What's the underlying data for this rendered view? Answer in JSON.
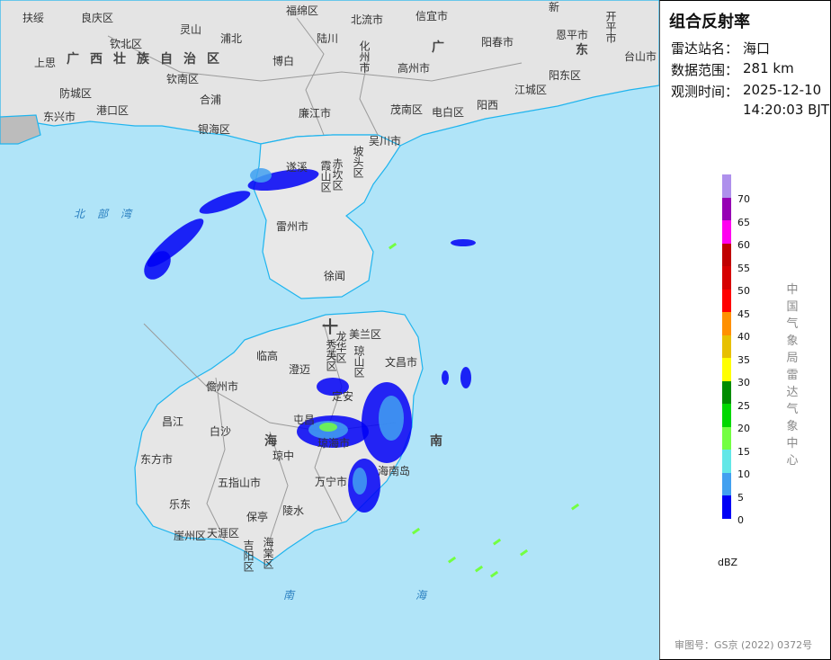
{
  "map": {
    "labels": [
      "扶绥",
      "良庆区",
      "福绵区",
      "北流市",
      "信宜市",
      "新",
      "灵山",
      "钦北区",
      "浦北",
      "陆川",
      "化州市",
      "广",
      "阳春市",
      "恩平市",
      "开平市",
      "台山市",
      "上思",
      "广西壮族自治区",
      "博白",
      "高州市",
      "东",
      "钦南区",
      "阳东区",
      "防城区",
      "合浦",
      "江城区",
      "东兴市",
      "港口区",
      "廉江市",
      "茂南区",
      "电白区",
      "阳西",
      "银海区",
      "吴川市",
      "坡头区",
      "遂溪",
      "赤坎区",
      "霞山区",
      "雷州市",
      "徐闻",
      "秀英区",
      "龙华区",
      "美兰区",
      "琼山区",
      "临高",
      "澄迈",
      "文昌市",
      "儋州市",
      "定安",
      "屯昌",
      "昌江",
      "琼海市",
      "白沙",
      "海",
      "南",
      "琼中",
      "东方市",
      "海南岛",
      "万宁市",
      "五指山市",
      "乐东",
      "保亭",
      "陵水",
      "崖州区",
      "天涯区",
      "吉阳区",
      "海棠区"
    ],
    "sea_labels": [
      "北部湾",
      "南",
      "海"
    ],
    "radar_center_marker": "十"
  },
  "panel": {
    "title": "组合反射率",
    "station_label": "雷达站名：",
    "station_value": "海口",
    "range_label": "数据范围：",
    "range_value": "281 km",
    "time_label": "观测时间：",
    "time_date": "2025-12-10",
    "time_clock": "14:20:03 BJT",
    "legend": {
      "colors": [
        "#ae90ec",
        "#9600b4",
        "#ff00f0",
        "#c00000",
        "#d60000",
        "#ff0000",
        "#ff9000",
        "#e7c000",
        "#ffff00",
        "#008c00",
        "#00d800",
        "#73ff42",
        "#63e7e7",
        "#42a0f0",
        "#0000f6"
      ],
      "ticks": [
        "70",
        "65",
        "60",
        "55",
        "50",
        "45",
        "40",
        "35",
        "30",
        "25",
        "20",
        "15",
        "10",
        "5",
        "0"
      ],
      "unit": "dBZ"
    },
    "organization": "中国气象局雷达气象中心",
    "approval": "审图号：GS京 (2022) 0372号"
  }
}
